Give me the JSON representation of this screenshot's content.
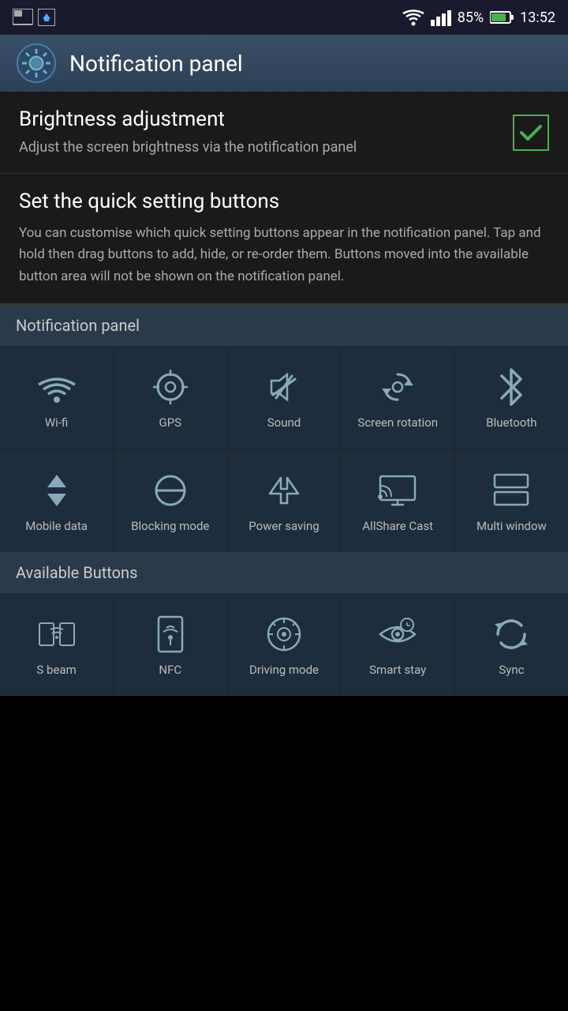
{
  "statusBar": {
    "battery": "85%",
    "time": "13:52"
  },
  "header": {
    "title": "Notification panel"
  },
  "brightness": {
    "title": "Brightness adjustment",
    "description": "Adjust the screen brightness via the notification panel",
    "checked": true
  },
  "quickSetting": {
    "title": "Set the quick setting buttons",
    "description": "You can customise which quick setting buttons appear in the notification panel. Tap and hold then drag buttons to add, hide, or re-order them. Buttons moved into the available button area will not be shown on the notification panel."
  },
  "notificationPanel": {
    "sectionLabel": "Notification panel",
    "buttons": [
      {
        "id": "wifi",
        "label": "Wi-fi"
      },
      {
        "id": "gps",
        "label": "GPS"
      },
      {
        "id": "sound",
        "label": "Sound"
      },
      {
        "id": "screen-rotation",
        "label": "Screen\nrotation"
      },
      {
        "id": "bluetooth",
        "label": "Bluetooth"
      },
      {
        "id": "mobile-data",
        "label": "Mobile data"
      },
      {
        "id": "blocking-mode",
        "label": "Blocking\nmode"
      },
      {
        "id": "power-saving",
        "label": "Power\nsaving"
      },
      {
        "id": "allshare-cast",
        "label": "AllShare\nCast"
      },
      {
        "id": "multi-window",
        "label": "Multi\nwindow"
      }
    ]
  },
  "availableButtons": {
    "sectionLabel": "Available Buttons",
    "buttons": [
      {
        "id": "s-beam",
        "label": "S beam"
      },
      {
        "id": "nfc",
        "label": "NFC"
      },
      {
        "id": "driving-mode",
        "label": "Driving\nmode"
      },
      {
        "id": "smart-stay",
        "label": "Smart stay"
      },
      {
        "id": "sync",
        "label": "Sync"
      }
    ]
  }
}
